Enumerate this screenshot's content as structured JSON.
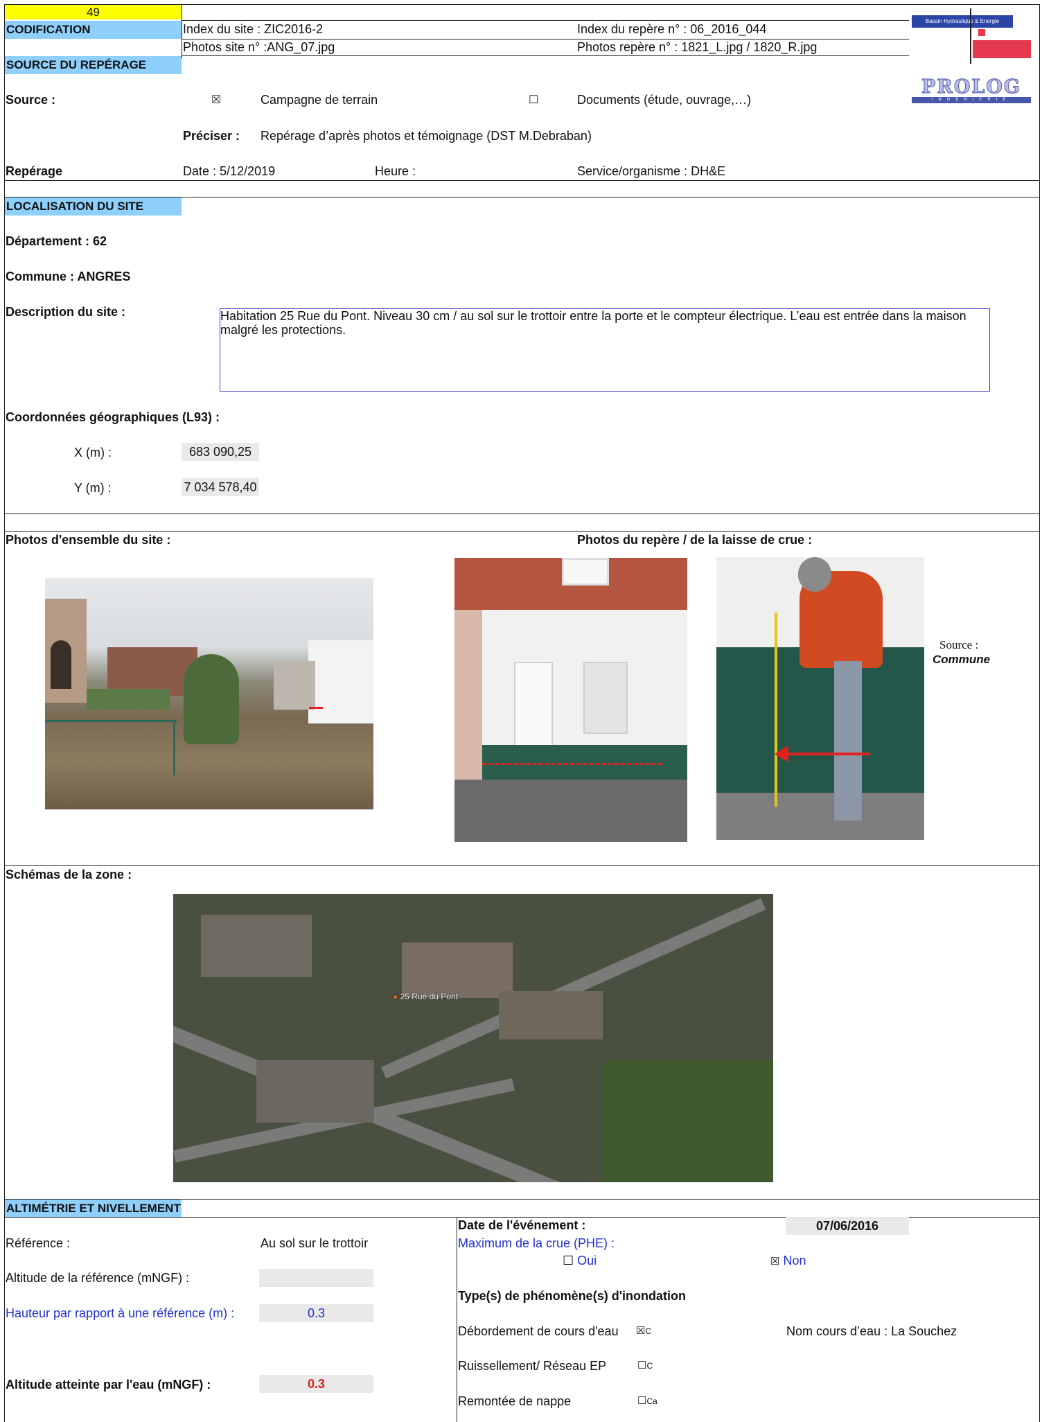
{
  "header": {
    "sheet_number": "49",
    "codification_label": "CODIFICATION",
    "site_index": "Index du site : ZIC2016-2",
    "benchmark_index": "Index du repère n° : 06_2016_044",
    "site_photos": "Photos site n° :ANG_07.jpg",
    "benchmark_photos": "Photos repère n° : 1821_L.jpg / 1820_R.jpg",
    "logo_top": "Bassin Hydraulique & Energie",
    "logo_prolog": "PROLOG",
    "logo_prolog_sub": "INGENIERIE"
  },
  "source": {
    "section_title": "SOURCE DU REPÉRAGE",
    "label": "Source :",
    "option1_mark": "☒",
    "option1": "Campagne de terrain",
    "option2_mark": "☐",
    "option2": "Documents (étude, ouvrage,…)",
    "preciser_label": "Préciser :",
    "preciser_value": "Repérage d’après photos et témoignage (DST M.Debraban)",
    "reperage_label": "Repérage",
    "date": "Date : 5/12/2019",
    "heure": "Heure :",
    "service": "Service/organisme :  DH&E"
  },
  "localisation": {
    "section_title": "LOCALISATION DU SITE",
    "departement": "Département :  62",
    "commune": "Commune : ANGRES",
    "description_label": "Description du site :",
    "description_text": "Habitation 25 Rue du Pont.  Niveau  30 cm  / au sol sur le trottoir entre la porte et le compteur électrique. L’eau est entrée dans la maison malgré les protections.",
    "coords_label": "Coordonnées géographiques (L93) :",
    "x_label": "X (m) :",
    "x_value": "683 090,25",
    "y_label": "Y (m) :",
    "y_value": "7 034 578,40"
  },
  "photos": {
    "site_label": "Photos d'ensemble du site :",
    "benchmark_label": "Photos du repère / de la laisse de crue  :",
    "source_label": "Source :",
    "source_value": "Commune"
  },
  "schema": {
    "label": "Schémas de la zone :",
    "map_label": "25 Rue du Pont"
  },
  "altimetrie": {
    "section_title": "ALTIMÉTRIE ET NIVELLEMENT",
    "reference_label": "Référence :",
    "reference_value": "Au sol sur le trottoir",
    "altitude_ref_label": "Altitude de la référence (mNGF)  :",
    "altitude_ref_value": "",
    "hauteur_label": "Hauteur par rapport à une référence (m) :",
    "hauteur_value": "0.3",
    "altitude_eau_label": "Altitude atteinte par l'eau (mNGF) :",
    "altitude_eau_value": "0.3",
    "event_date_label": "Date de l'événement :",
    "event_date_value": "07/06/2016",
    "phe_label": "Maximum de la crue (PHE) :",
    "phe_oui_mark": "☐",
    "phe_oui": "Oui",
    "phe_non_mark": "☒",
    "phe_non": "Non",
    "types_label": "Type(s) de phénomène(s) d'inondation",
    "type1": "Débordement de cours d'eau",
    "type1_mark": "☒",
    "type1_suffix": "C",
    "river_name": "Nom cours d’eau : La Souchez",
    "type2": "Ruissellement/ Réseau EP",
    "type2_mark": "☐",
    "type2_suffix": "C",
    "type3": "Remontée de nappe",
    "type3_mark": "☐",
    "type3_suffix": "Ca"
  },
  "colors": {
    "section_bg": "#8fcffb",
    "yellow": "#ffff00",
    "blue_text": "#1f2fcf",
    "red_value": "#e02020"
  }
}
